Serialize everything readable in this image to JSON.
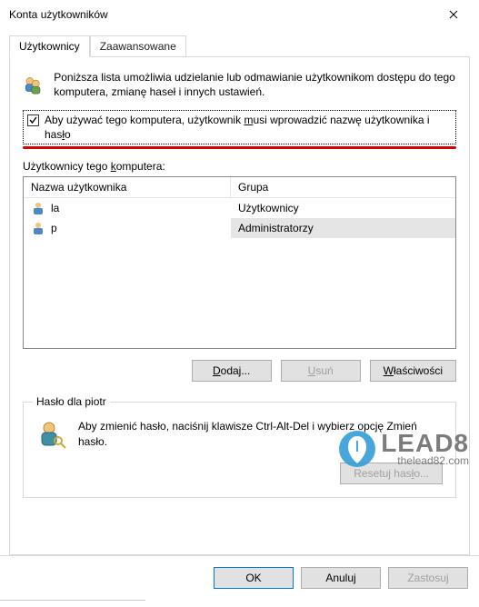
{
  "window": {
    "title": "Konta użytkowników"
  },
  "tabs": {
    "active": "Użytkownicy",
    "inactive": "Zaawansowane"
  },
  "intro": "Poniższa lista umożliwia udzielanie lub odmawianie użytkownikom dostępu do tego komputera, zmianę haseł i innych ustawień.",
  "checkbox": {
    "checked": true,
    "label_pre": "Aby używać tego komputera, użytkownik ",
    "label_u": "m",
    "label_mid": "usi wprowadzić nazwę użytkownika i has",
    "label_u2": "ł",
    "label_post": "o"
  },
  "list": {
    "caption_pre": "Użytkownicy tego ",
    "caption_u": "k",
    "caption_post": "omputera:",
    "headers": {
      "c1": "Nazwa użytkownika",
      "c2": "Grupa"
    },
    "rows": [
      {
        "name": "la",
        "group": "Użytkownicy",
        "selected": false
      },
      {
        "name": "p",
        "group": "Administratorzy",
        "selected": true
      }
    ]
  },
  "buttons": {
    "add_u": "D",
    "add_post": "odaj...",
    "remove_u": "U",
    "remove_post": "suń",
    "props_u": "W",
    "props_post": "łaściwości",
    "reset_pre": "Resetuj has",
    "reset_u": "ł",
    "reset_post": "o..."
  },
  "group": {
    "title": "Hasło dla piotr",
    "text": "Aby zmienić hasło, naciśnij klawisze Ctrl-Alt-Del i wybierz opcję Zmień hasło."
  },
  "dialog_buttons": {
    "ok": "OK",
    "cancel": "Anuluj",
    "apply": "Zastosuj"
  },
  "watermark": {
    "big": "LEAD8",
    "small": "thelead82.com"
  }
}
